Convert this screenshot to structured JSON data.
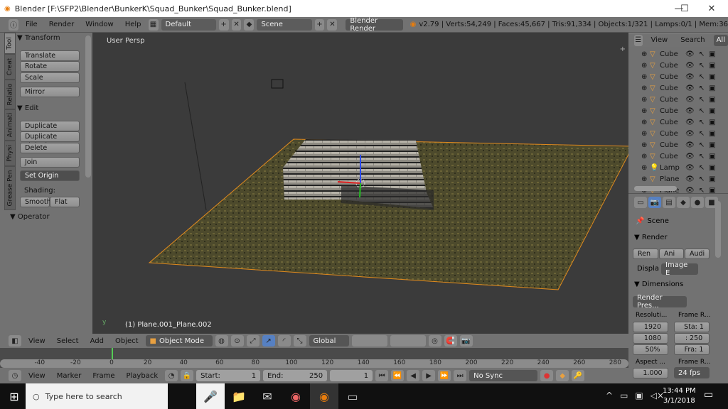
{
  "window": {
    "title": "Blender [F:\\SFP2\\Blender\\BunkerK\\Squad_Bunker\\Squad_Bunker.blend]",
    "minimize": "—",
    "maximize": "☐",
    "close": "✕"
  },
  "topbar": {
    "menus": [
      "File",
      "Render",
      "Window",
      "Help"
    ],
    "layout": "Default",
    "scene": "Scene",
    "engine": "Blender Render",
    "stats": "v2.79 | Verts:54,249 | Faces:45,667 | Tris:91,334 | Objects:1/321 | Lamps:0/1 | Mem:36"
  },
  "toolshelf": {
    "tabs": [
      "Tool",
      "Creat",
      "Relatio",
      "Animati",
      "Physi",
      "Grease Pen"
    ],
    "transform": {
      "title": "▼ Transform",
      "buttons": [
        "Translate",
        "Rotate",
        "Scale",
        "Mirror"
      ]
    },
    "edit": {
      "title": "▼ Edit",
      "buttons": [
        "Duplicate",
        "Duplicate Linked",
        "Delete",
        "Join"
      ],
      "set_origin": "Set Origin",
      "shading_label": "Shading:",
      "smooth": "Smooth",
      "flat": "Flat"
    },
    "operator": "▼ Operator"
  },
  "viewport": {
    "view_label": "User Persp",
    "object_label": "(1) Plane.001_Plane.002"
  },
  "outliner": {
    "view": "View",
    "search": "Search",
    "filter": "All",
    "items": [
      "Cube",
      "Cube",
      "Cube",
      "Cube",
      "Cube",
      "Cube",
      "Cube",
      "Cube",
      "Cube",
      "Cube",
      "Lamp",
      "Plane",
      "Plane"
    ]
  },
  "properties": {
    "scene": "Scene",
    "render_title": "▼ Render",
    "render_buttons": [
      "Ren",
      "Ani",
      "Audi"
    ],
    "display_label": "Displa",
    "display_value": "Image E",
    "dimensions_title": "▼ Dimensions",
    "preset": "Render Pres...",
    "resolution_label": "Resoluti...",
    "res_x": "1920",
    "res_y": "1080",
    "res_pct": "50%",
    "frame_range_label": "Frame R...",
    "start": "Sta: 1",
    "end": ": 250",
    "frame_step": "Fra: 1",
    "aspect_label": "Aspect ...",
    "aspect_x": "1.000",
    "frame_rate_label": "Frame R...",
    "fps": "24 fps"
  },
  "view3d_header": {
    "menus": [
      "View",
      "Select",
      "Add",
      "Object"
    ],
    "mode": "Object Mode",
    "orientation": "Global"
  },
  "timeline": {
    "ticks": [
      "-40",
      "-20",
      "0",
      "20",
      "40",
      "60",
      "80",
      "100",
      "120",
      "140",
      "160",
      "180",
      "200",
      "220",
      "240",
      "260",
      "280"
    ],
    "current_frame": 1
  },
  "timeline_header": {
    "menus": [
      "View",
      "Marker",
      "Frame",
      "Playback"
    ],
    "start": "Start:",
    "start_value": "1",
    "end": "End:",
    "end_value": "250",
    "current": "1",
    "sync": "No Sync"
  },
  "taskbar": {
    "search_placeholder": "Type here to search",
    "time": "13:44 PM",
    "date": "3/1/2018"
  }
}
